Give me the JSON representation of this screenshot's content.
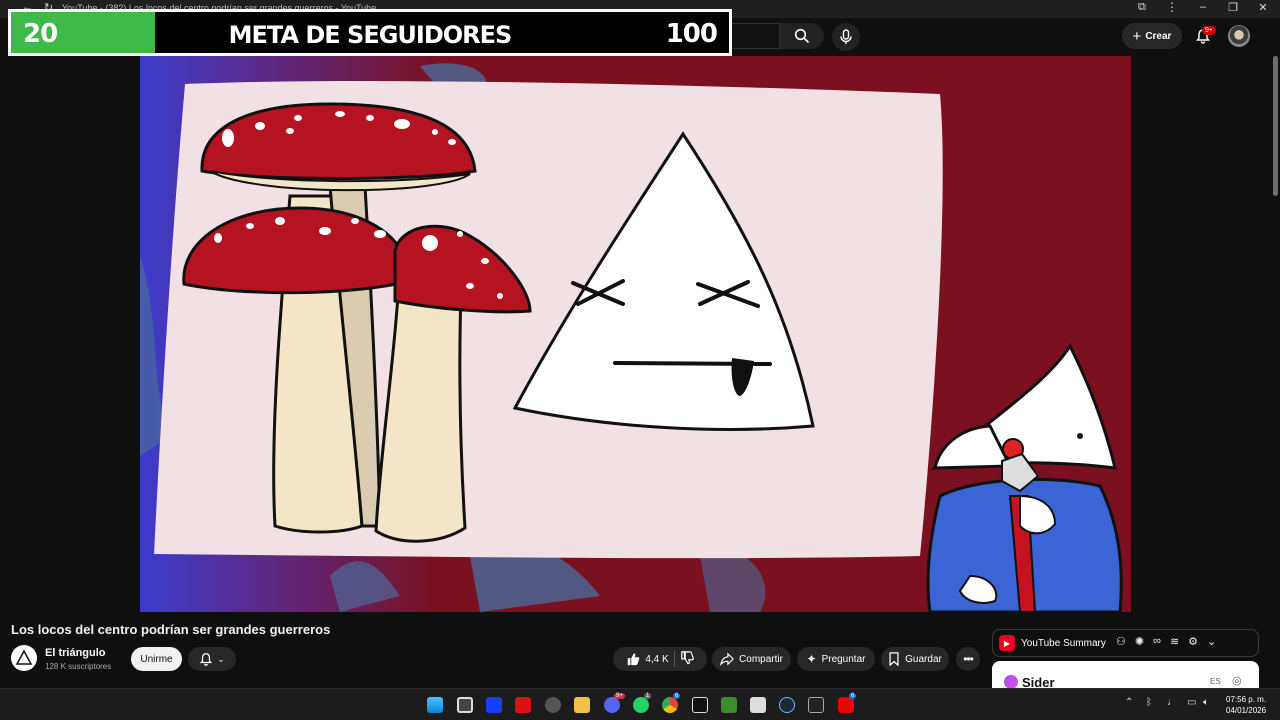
{
  "browser": {
    "tab_title": "YouTube - (382) Los locos del centro podrían ser grandes guerreros - YouTube"
  },
  "goal_overlay": {
    "current": "20",
    "title": "META DE SEGUIDORES",
    "target": "100",
    "progress": 0.2,
    "fill_color": "#3fb94a"
  },
  "header": {
    "create_label": "Crear",
    "notifications_badge": "9+"
  },
  "video": {
    "title": "Los locos del centro podrían ser grandes guerreros",
    "background_color": "#7a1020"
  },
  "channel": {
    "name": "El triángulo",
    "subscribers": "128 K suscriptores",
    "join_label": "Unirme"
  },
  "actions": {
    "likes": "4,4 K",
    "share_label": "Compartir",
    "ask_label": "Preguntar",
    "save_label": "Guardar"
  },
  "side_panel": {
    "summary_label": "YouTube Summary",
    "sider_label": "Sider",
    "sider_lang": "ES"
  },
  "taskbar": {
    "time": "07:56 p. m.",
    "date": "04/01/2026",
    "badges": [
      "9+",
      "1",
      "6",
      "6"
    ]
  }
}
